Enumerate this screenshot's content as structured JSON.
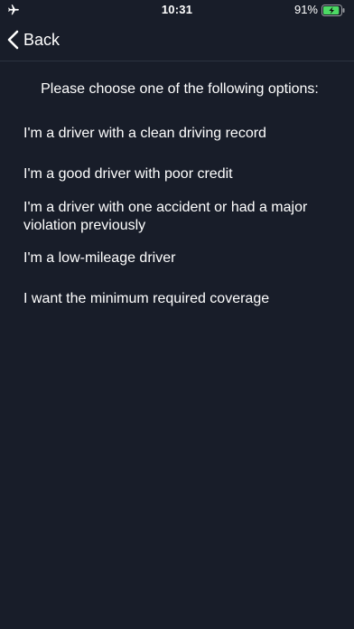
{
  "status_bar": {
    "time": "10:31",
    "battery_percent": "91%",
    "battery_level": 0.91,
    "charging": true,
    "airplane_icon": "airplane-icon",
    "battery_color": "#4cd964"
  },
  "nav": {
    "back_label": "Back",
    "back_icon": "chevron-left-icon"
  },
  "prompt": "Please choose one of the following options:",
  "options": [
    {
      "label": "I'm a driver with a clean driving record"
    },
    {
      "label": "I'm a good driver with poor credit"
    },
    {
      "label": "I'm a driver with one accident or had a major violation previously"
    },
    {
      "label": "I'm a low-mileage driver"
    },
    {
      "label": "I want the minimum required coverage"
    }
  ],
  "colors": {
    "background": "#181d29",
    "text": "#ffffff",
    "divider": "#2c3240"
  }
}
